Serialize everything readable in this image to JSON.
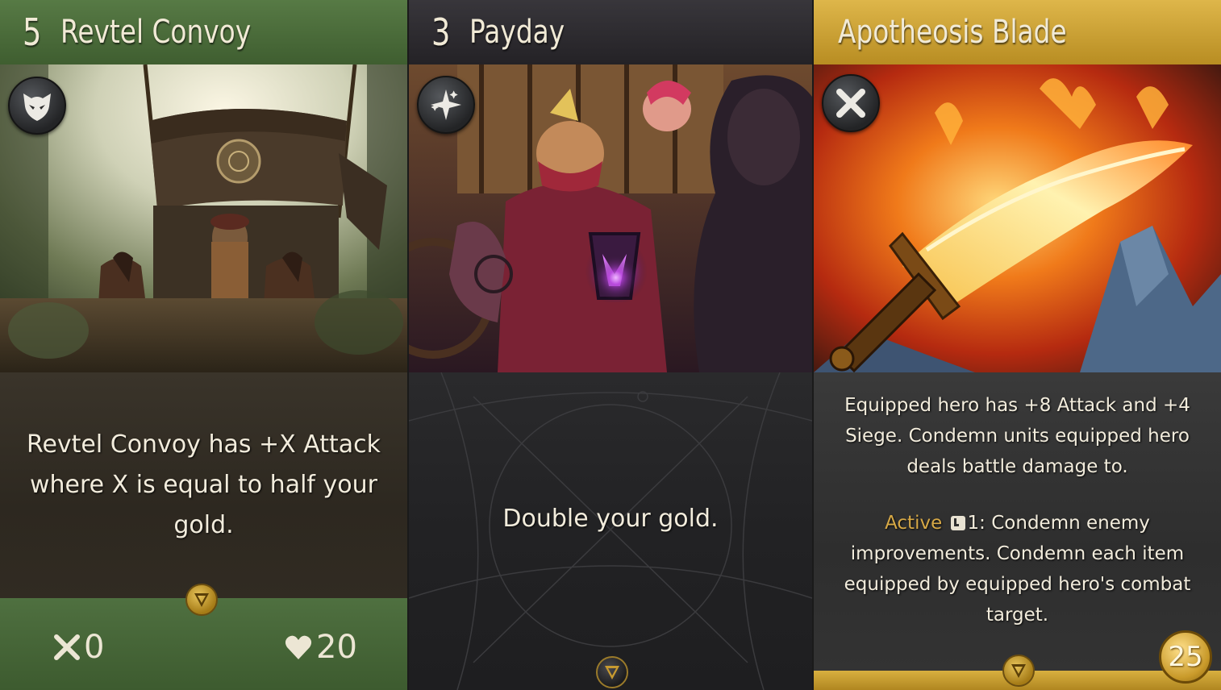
{
  "cards": [
    {
      "cost": "5",
      "name": "Revtel Convoy",
      "type_icon": "creep-mask-icon",
      "rules_text": "Revtel Convoy has +X Attack where X is equal to half your gold.",
      "attack": "0",
      "health": "20",
      "frame_color": "#4a6b3a",
      "set_icon": "set-emblem-icon"
    },
    {
      "cost": "3",
      "name": "Payday",
      "type_icon": "spell-sparkle-icon",
      "rules_text": "Double your gold.",
      "frame_color": "#2e2c31",
      "set_icon": "set-emblem-icon"
    },
    {
      "name": "Apotheosis Blade",
      "type_icon": "weapon-crossed-swords-icon",
      "rules_text": "Equipped hero has +8 Attack and +4 Siege. Condemn units equipped hero deals battle damage to.",
      "active_label": "Active",
      "active_cooldown": "1:",
      "active_text": "Condemn enemy improvements. Condemn each item equipped by equipped hero's combat target.",
      "gold_cost": "25",
      "frame_color": "#d2a93a",
      "set_icon": "set-emblem-icon"
    }
  ]
}
